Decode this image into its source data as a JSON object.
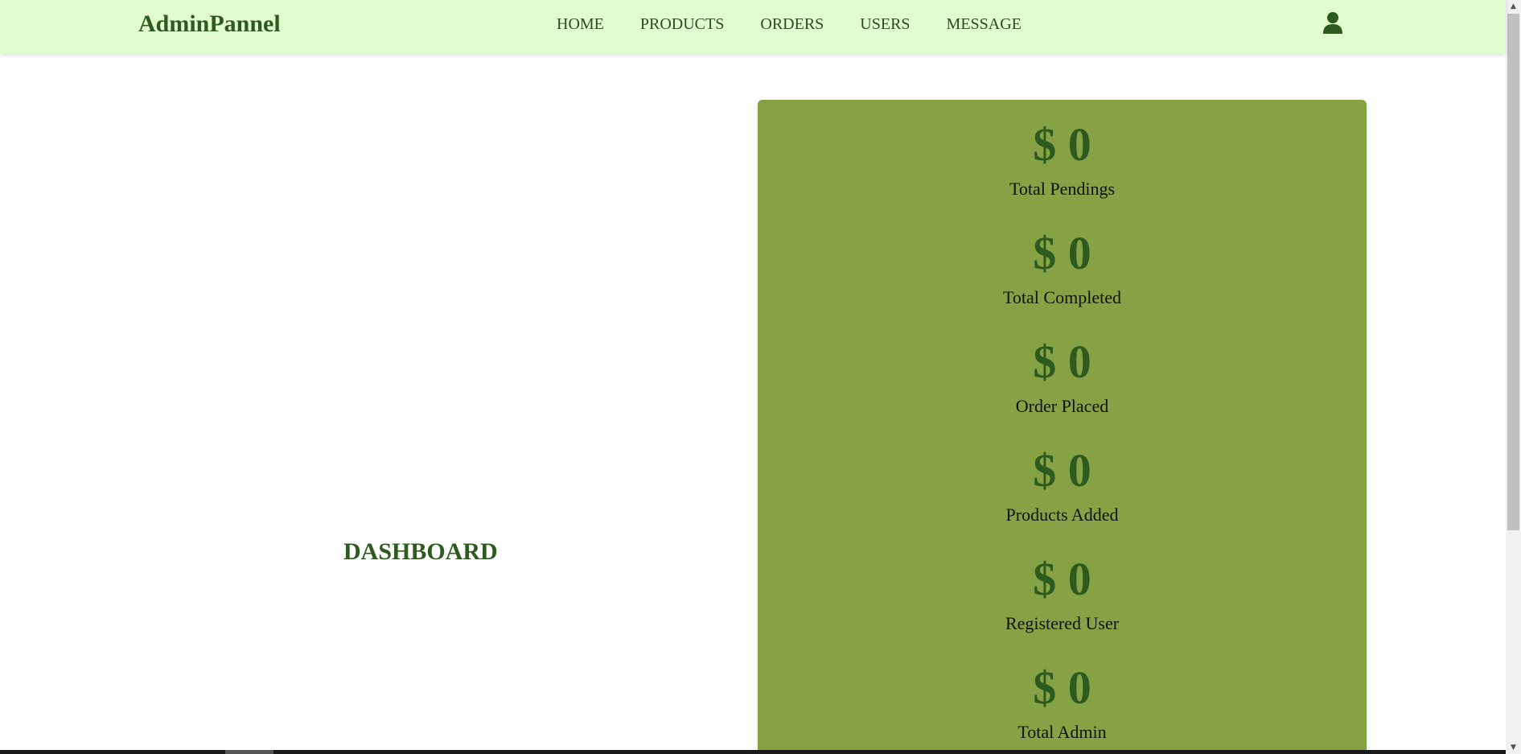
{
  "header": {
    "logo": "AdminPannel",
    "nav": [
      {
        "label": "HOME"
      },
      {
        "label": "PRODUCTS"
      },
      {
        "label": "ORDERS"
      },
      {
        "label": "USERS"
      },
      {
        "label": "MESSAGE"
      }
    ],
    "user_icon": "user-icon"
  },
  "main": {
    "title": "DASHBOARD",
    "stats": [
      {
        "value": "$ 0",
        "label": "Total Pendings"
      },
      {
        "value": "$ 0",
        "label": "Total Completed"
      },
      {
        "value": "$ 0",
        "label": "Order Placed"
      },
      {
        "value": "$ 0",
        "label": "Products Added"
      },
      {
        "value": "$ 0",
        "label": "Registered User"
      },
      {
        "value": "$ 0",
        "label": "Total Admin"
      }
    ]
  },
  "colors": {
    "header_bg": "#e1fccf",
    "brand_green": "#2d5a1e",
    "card_bg": "#87a244"
  }
}
